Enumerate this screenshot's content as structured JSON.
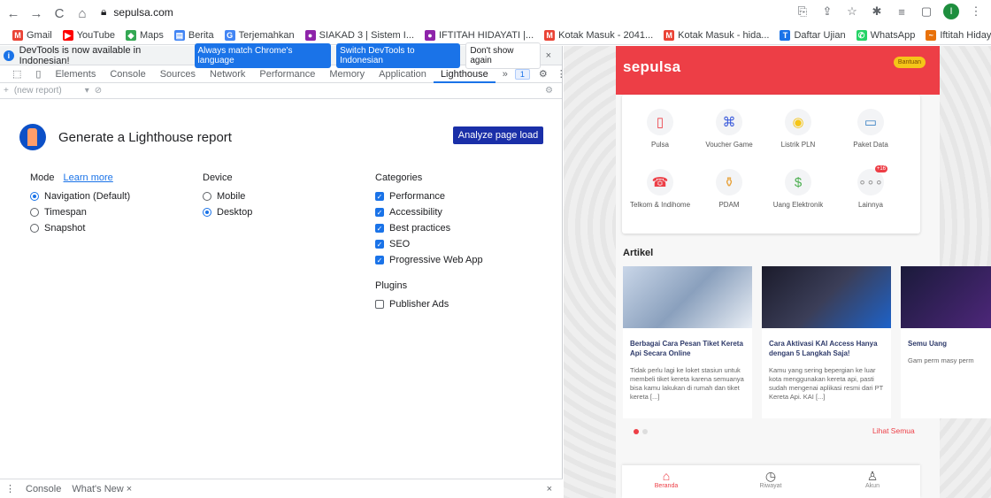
{
  "browser": {
    "url": "sepulsa.com",
    "nav": {
      "back": "←",
      "forward": "→",
      "reload": "C",
      "home": "⌂"
    },
    "avatar_letter": "I"
  },
  "bookmarks": [
    {
      "label": "Gmail",
      "color": "#ea4335",
      "icon": "M"
    },
    {
      "label": "YouTube",
      "color": "#ff0000",
      "icon": "▶"
    },
    {
      "label": "Maps",
      "color": "#34a853",
      "icon": "◆"
    },
    {
      "label": "Berita",
      "color": "#4285f4",
      "icon": "▤"
    },
    {
      "label": "Terjemahkan",
      "color": "#4285f4",
      "icon": "G"
    },
    {
      "label": "SIAKAD 3 | Sistem I...",
      "color": "#8e24aa",
      "icon": "●"
    },
    {
      "label": "IFTITAH HIDAYATI |...",
      "color": "#8e24aa",
      "icon": "●"
    },
    {
      "label": "Kotak Masuk - 2041...",
      "color": "#ea4335",
      "icon": "M"
    },
    {
      "label": "Kotak Masuk - hida...",
      "color": "#ea4335",
      "icon": "M"
    },
    {
      "label": "Daftar Ujian",
      "color": "#1a73e8",
      "icon": "T"
    },
    {
      "label": "WhatsApp",
      "color": "#25d366",
      "icon": "✆"
    },
    {
      "label": "Iftitah Hidayati – O...",
      "color": "#e8710a",
      "icon": "~"
    }
  ],
  "devtools": {
    "info": {
      "message": "DevTools is now available in Indonesian!",
      "btn_match": "Always match Chrome's language",
      "btn_switch": "Switch DevTools to Indonesian",
      "btn_dismiss": "Don't show again"
    },
    "tabs": [
      "Elements",
      "Console",
      "Sources",
      "Network",
      "Performance",
      "Memory",
      "Application",
      "Lighthouse",
      "»"
    ],
    "issue_count": "1",
    "report_placeholder": "(new report)",
    "lighthouse": {
      "title": "Generate a Lighthouse report",
      "analyze_button": "Analyze page load",
      "mode": {
        "heading": "Mode",
        "learn_more": "Learn more",
        "options": [
          "Navigation (Default)",
          "Timespan",
          "Snapshot"
        ],
        "selected": 0
      },
      "device": {
        "heading": "Device",
        "options": [
          "Mobile",
          "Desktop"
        ],
        "selected": 1
      },
      "categories": {
        "heading": "Categories",
        "options": [
          "Performance",
          "Accessibility",
          "Best practices",
          "SEO",
          "Progressive Web App"
        ]
      },
      "plugins": {
        "heading": "Plugins",
        "options": [
          "Publisher Ads"
        ]
      }
    },
    "drawer": {
      "console": "Console",
      "whats_new": "What's New ×"
    }
  },
  "sepulsa": {
    "brand": "sepulsa",
    "help_label": "Bantuan",
    "services": [
      {
        "label": "Pulsa",
        "icon": "▯",
        "color": "#ed3e46"
      },
      {
        "label": "Voucher Game",
        "icon": "⌘",
        "color": "#3b5bdb"
      },
      {
        "label": "Listrik PLN",
        "icon": "◉",
        "color": "#f5c518"
      },
      {
        "label": "Paket Data",
        "icon": "▭",
        "color": "#3b82c4"
      },
      {
        "label": "Telkom & Indihome",
        "icon": "☎",
        "color": "#ed3e46"
      },
      {
        "label": "PDAM",
        "icon": "⚱",
        "color": "#e8a33d"
      },
      {
        "label": "Uang Elektronik",
        "icon": "$",
        "color": "#4caf50"
      },
      {
        "label": "Lainnya",
        "icon": "∘∘∘",
        "color": "#999",
        "badge": "+16"
      }
    ],
    "article_heading": "Artikel",
    "articles": [
      {
        "title": "Berbagai Cara Pesan Tiket Kereta Api Secara Online",
        "desc": "Tidak perlu lagi ke loket stasiun untuk membeli tiket kereta karena semuanya bisa kamu lakukan di rumah dan tiket kereta [...]"
      },
      {
        "title": "Cara Aktivasi KAI Access Hanya dengan 5 Langkah Saja!",
        "desc": "Kamu yang sering bepergian ke luar kota menggunakan kereta api, pasti sudah mengenai aplikasi resmi dari PT Kereta Api. KAI [...]"
      },
      {
        "title": "Semu Uang",
        "desc": "Gam perm masy perm"
      }
    ],
    "see_all": "Lihat Semua",
    "bottom_nav": [
      "Beranda",
      "Riwayat",
      "Akun"
    ]
  },
  "colors": {
    "brand_red": "#ed3e46",
    "devtools_blue": "#1a73e8",
    "analyze_blue": "#1a2fa8"
  }
}
